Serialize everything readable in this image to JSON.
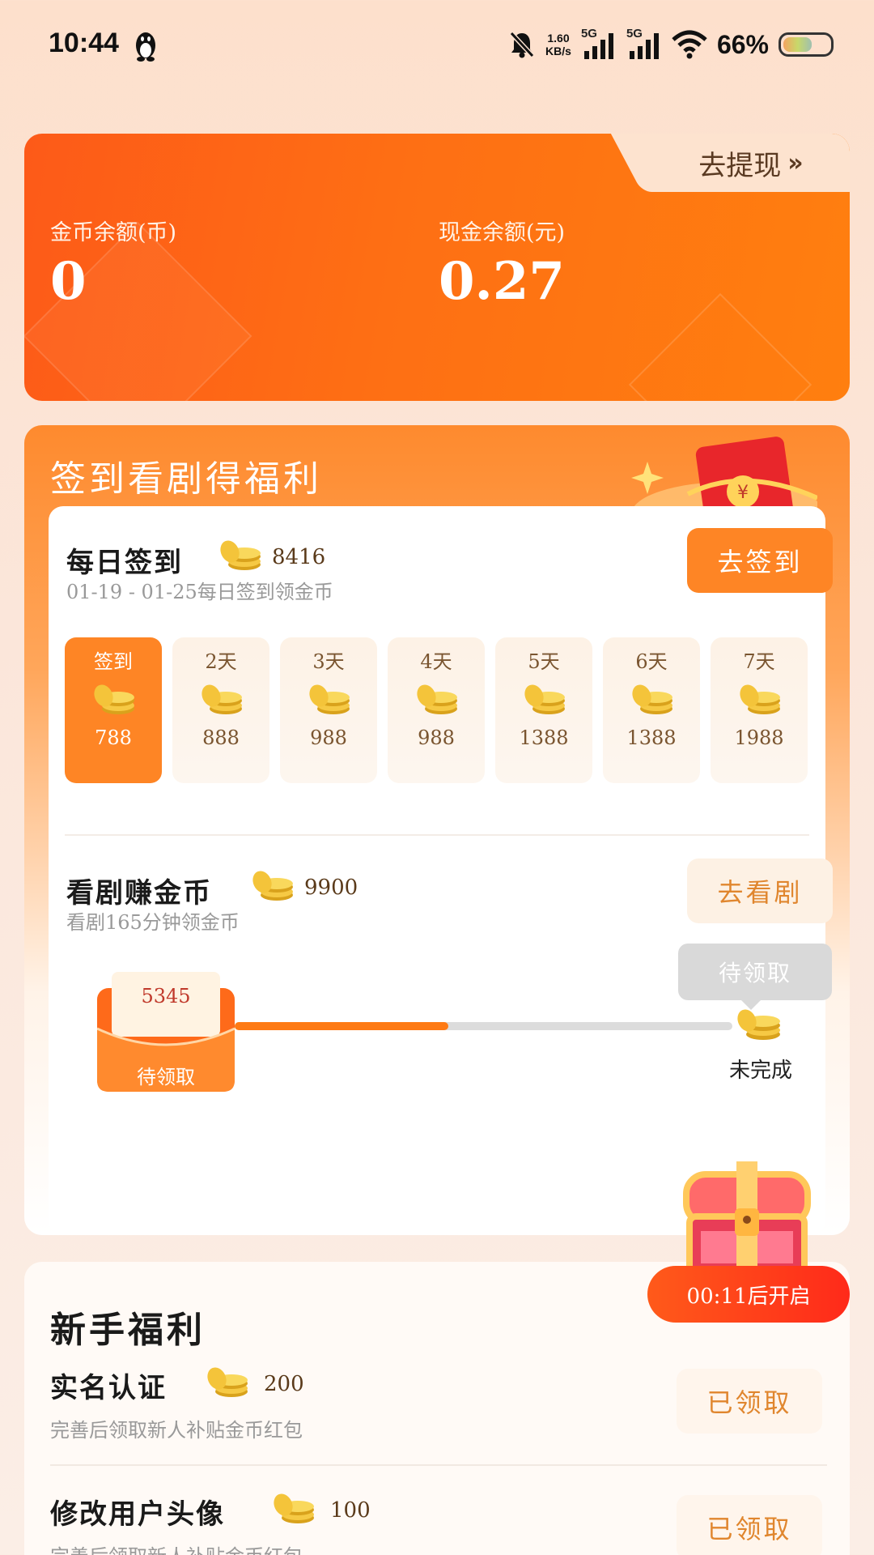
{
  "status_bar": {
    "time": "10:44",
    "net_speed_value": "1.60",
    "net_speed_unit": "KB/s",
    "signal1_label": "5G",
    "signal2_label": "5G",
    "battery_percent": "66%",
    "battery_level": 0.66
  },
  "balance": {
    "withdraw_label": "去提现",
    "withdraw_arrow": "»",
    "coin_label": "金币余额(币)",
    "coin_value": "0",
    "cash_label": "现金余额(元)",
    "cash_value": "0.27"
  },
  "signin_section": {
    "title": "签到看剧得福利",
    "daily": {
      "title": "每日签到",
      "coins": "8416",
      "subtitle": "01-19 - 01-25每日签到领金币",
      "button": "去签到",
      "days": [
        {
          "label": "签到",
          "value": "788",
          "active": true
        },
        {
          "label": "2天",
          "value": "888",
          "active": false
        },
        {
          "label": "3天",
          "value": "988",
          "active": false
        },
        {
          "label": "4天",
          "value": "988",
          "active": false
        },
        {
          "label": "5天",
          "value": "1388",
          "active": false
        },
        {
          "label": "6天",
          "value": "1388",
          "active": false
        },
        {
          "label": "7天",
          "value": "1988",
          "active": false
        }
      ]
    },
    "watch": {
      "title": "看剧赚金币",
      "coins": "9900",
      "subtitle": "看剧165分钟领金币",
      "button": "去看剧",
      "envelope_amount": "5345",
      "envelope_status": "待领取",
      "tooltip": "待领取",
      "end_status": "未完成",
      "progress": 0.43
    }
  },
  "newbie": {
    "title": "新手福利",
    "items": [
      {
        "title": "实名认证",
        "coins": "200",
        "subtitle": "完善后领取新人补贴金币红包",
        "button": "已领取"
      },
      {
        "title": "修改用户头像",
        "coins": "100",
        "subtitle": "完善后领取新人补贴金币红包",
        "button": "已领取"
      }
    ]
  },
  "chest": {
    "timer_label": "00:11后开启"
  },
  "colors": {
    "accent": "#fe8525",
    "balance_card": "#fe6414",
    "progress_fill": "#fe7a14"
  }
}
